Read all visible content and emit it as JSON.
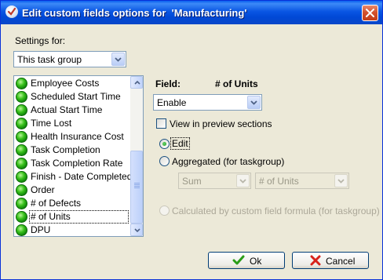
{
  "window": {
    "title": "Edit custom fields options for  'Manufacturing'"
  },
  "settings": {
    "label": "Settings for:",
    "selected": "This task group"
  },
  "field_list": {
    "items": [
      "Employee Costs",
      "Scheduled Start Time",
      "Actual Start Time",
      "Time Lost",
      "Health Insurance Cost",
      "Task Completion",
      "Task Completion Rate",
      "Finish - Date Completed",
      "Order",
      "# of Defects",
      "# of Units",
      "DPU"
    ],
    "selected_index": 10
  },
  "field": {
    "label": "Field:",
    "name": "# of Units",
    "mode_selected": "Enable",
    "view_in_preview": {
      "label": "View in preview sections",
      "checked": false
    },
    "options": {
      "edit": {
        "label": "Edit",
        "checked": true
      },
      "aggregated": {
        "label": "Aggregated (for taskgroup)",
        "checked": false
      },
      "aggregate_function": "Sum",
      "aggregate_field": "# of Units",
      "calculated": {
        "label": "Calculated by custom field formula (for taskgroup)",
        "enabled": false
      }
    }
  },
  "buttons": {
    "ok": "Ok",
    "cancel": "Cancel"
  },
  "colors": {
    "title_bar": "#0a56e3",
    "dialog_bg": "#ece9d8",
    "status_green": "#38c11b",
    "cancel_x": "#d8221b",
    "ok_check": "#2a9d18"
  }
}
